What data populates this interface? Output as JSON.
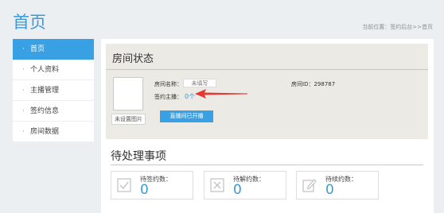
{
  "header": {
    "title": "首页",
    "breadcrumb": "当前位置：签约后台>>首页"
  },
  "sidebar": {
    "items": [
      {
        "label": "首页",
        "active": true
      },
      {
        "label": "个人资料",
        "active": false
      },
      {
        "label": "主播管理",
        "active": false
      },
      {
        "label": "签约信息",
        "active": false
      },
      {
        "label": "房间数据",
        "active": false
      }
    ]
  },
  "room": {
    "title": "房间状态",
    "name_label": "房间名称：",
    "name_value": "未填写",
    "id_text": "房间ID：298787",
    "anchor_label": "签约主播：",
    "anchor_count": "0个",
    "image_caption": "未设置图片",
    "open_button": "直播间已开播",
    "arrow_color": "#e53935"
  },
  "todo": {
    "title": "待处理事项",
    "items": [
      {
        "label": "待签约数：",
        "count": "0",
        "icon": "checkbox-icon"
      },
      {
        "label": "待解约数：",
        "count": "0",
        "icon": "x-box-icon"
      },
      {
        "label": "待续约数：",
        "count": "0",
        "icon": "edit-icon"
      }
    ]
  },
  "colors": {
    "accent": "#3aa0e4",
    "panel_bg": "#eceae4",
    "page_bg": "#eceff1"
  }
}
